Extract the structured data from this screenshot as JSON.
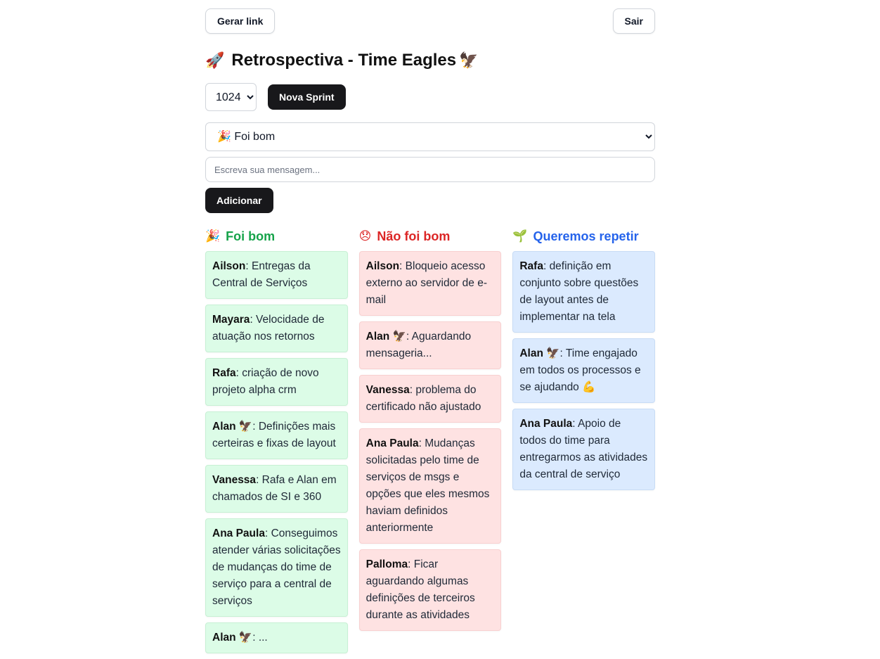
{
  "header": {
    "generate_link_label": "Gerar link",
    "logout_label": "Sair"
  },
  "title": {
    "icon": "🚀",
    "text": "Retrospectiva - Time Eagles",
    "trailing_icon": "🦅"
  },
  "sprint": {
    "selected": "1024",
    "new_sprint_label": "Nova Sprint"
  },
  "form": {
    "category_selected": "🎉 Foi bom",
    "message_placeholder": "Escreva sua mensagem...",
    "add_label": "Adicionar"
  },
  "columns": [
    {
      "icon": "🎉",
      "title": "Foi bom",
      "color": "#16a34a",
      "card_color": "#dcfce7",
      "cards": [
        {
          "author": "Ailson",
          "text": ": Entregas da Central de Serviços"
        },
        {
          "author": "Mayara",
          "text": ": Velocidade de atuação nos retornos"
        },
        {
          "author": "Rafa",
          "text": ": criação de novo projeto alpha crm"
        },
        {
          "author": "Alan 🦅",
          "text": ": Definições mais certeiras e fixas de layout"
        },
        {
          "author": "Vanessa",
          "text": ": Rafa e Alan em chamados de SI e 360"
        },
        {
          "author": "Ana Paula",
          "text": ": Conseguimos atender várias solicitações de mudanças do time de serviço para a central de serviços"
        },
        {
          "author": "Alan 🦅",
          "text": ": ..."
        }
      ]
    },
    {
      "icon": "😞",
      "title": "Não foi bom",
      "color": "#dc2626",
      "card_color": "#fee2e2",
      "cards": [
        {
          "author": "Ailson",
          "text": ": Bloqueio acesso externo ao servidor de e-mail"
        },
        {
          "author": "Alan 🦅",
          "text": ": Aguardando mensageria..."
        },
        {
          "author": "Vanessa",
          "text": ": problema do certificado não ajustado"
        },
        {
          "author": "Ana Paula",
          "text": ": Mudanças solicitadas pelo time de serviços de msgs e opções que eles mesmos haviam definidos anteriormente"
        },
        {
          "author": "Palloma",
          "text": ": Ficar aguardando algumas definições de terceiros durante as atividades"
        }
      ]
    },
    {
      "icon": "🌱",
      "title": "Queremos repetir",
      "color": "#2563eb",
      "card_color": "#dbeafe",
      "cards": [
        {
          "author": "Rafa",
          "text": ": definição em conjunto sobre questões de layout antes de implementar na tela"
        },
        {
          "author": "Alan 🦅",
          "text": ": Time engajado em todos os processos e se ajudando 💪"
        },
        {
          "author": "Ana Paula",
          "text": ": Apoio de todos do time para entregarmos as atividades da central de serviço"
        }
      ]
    }
  ]
}
